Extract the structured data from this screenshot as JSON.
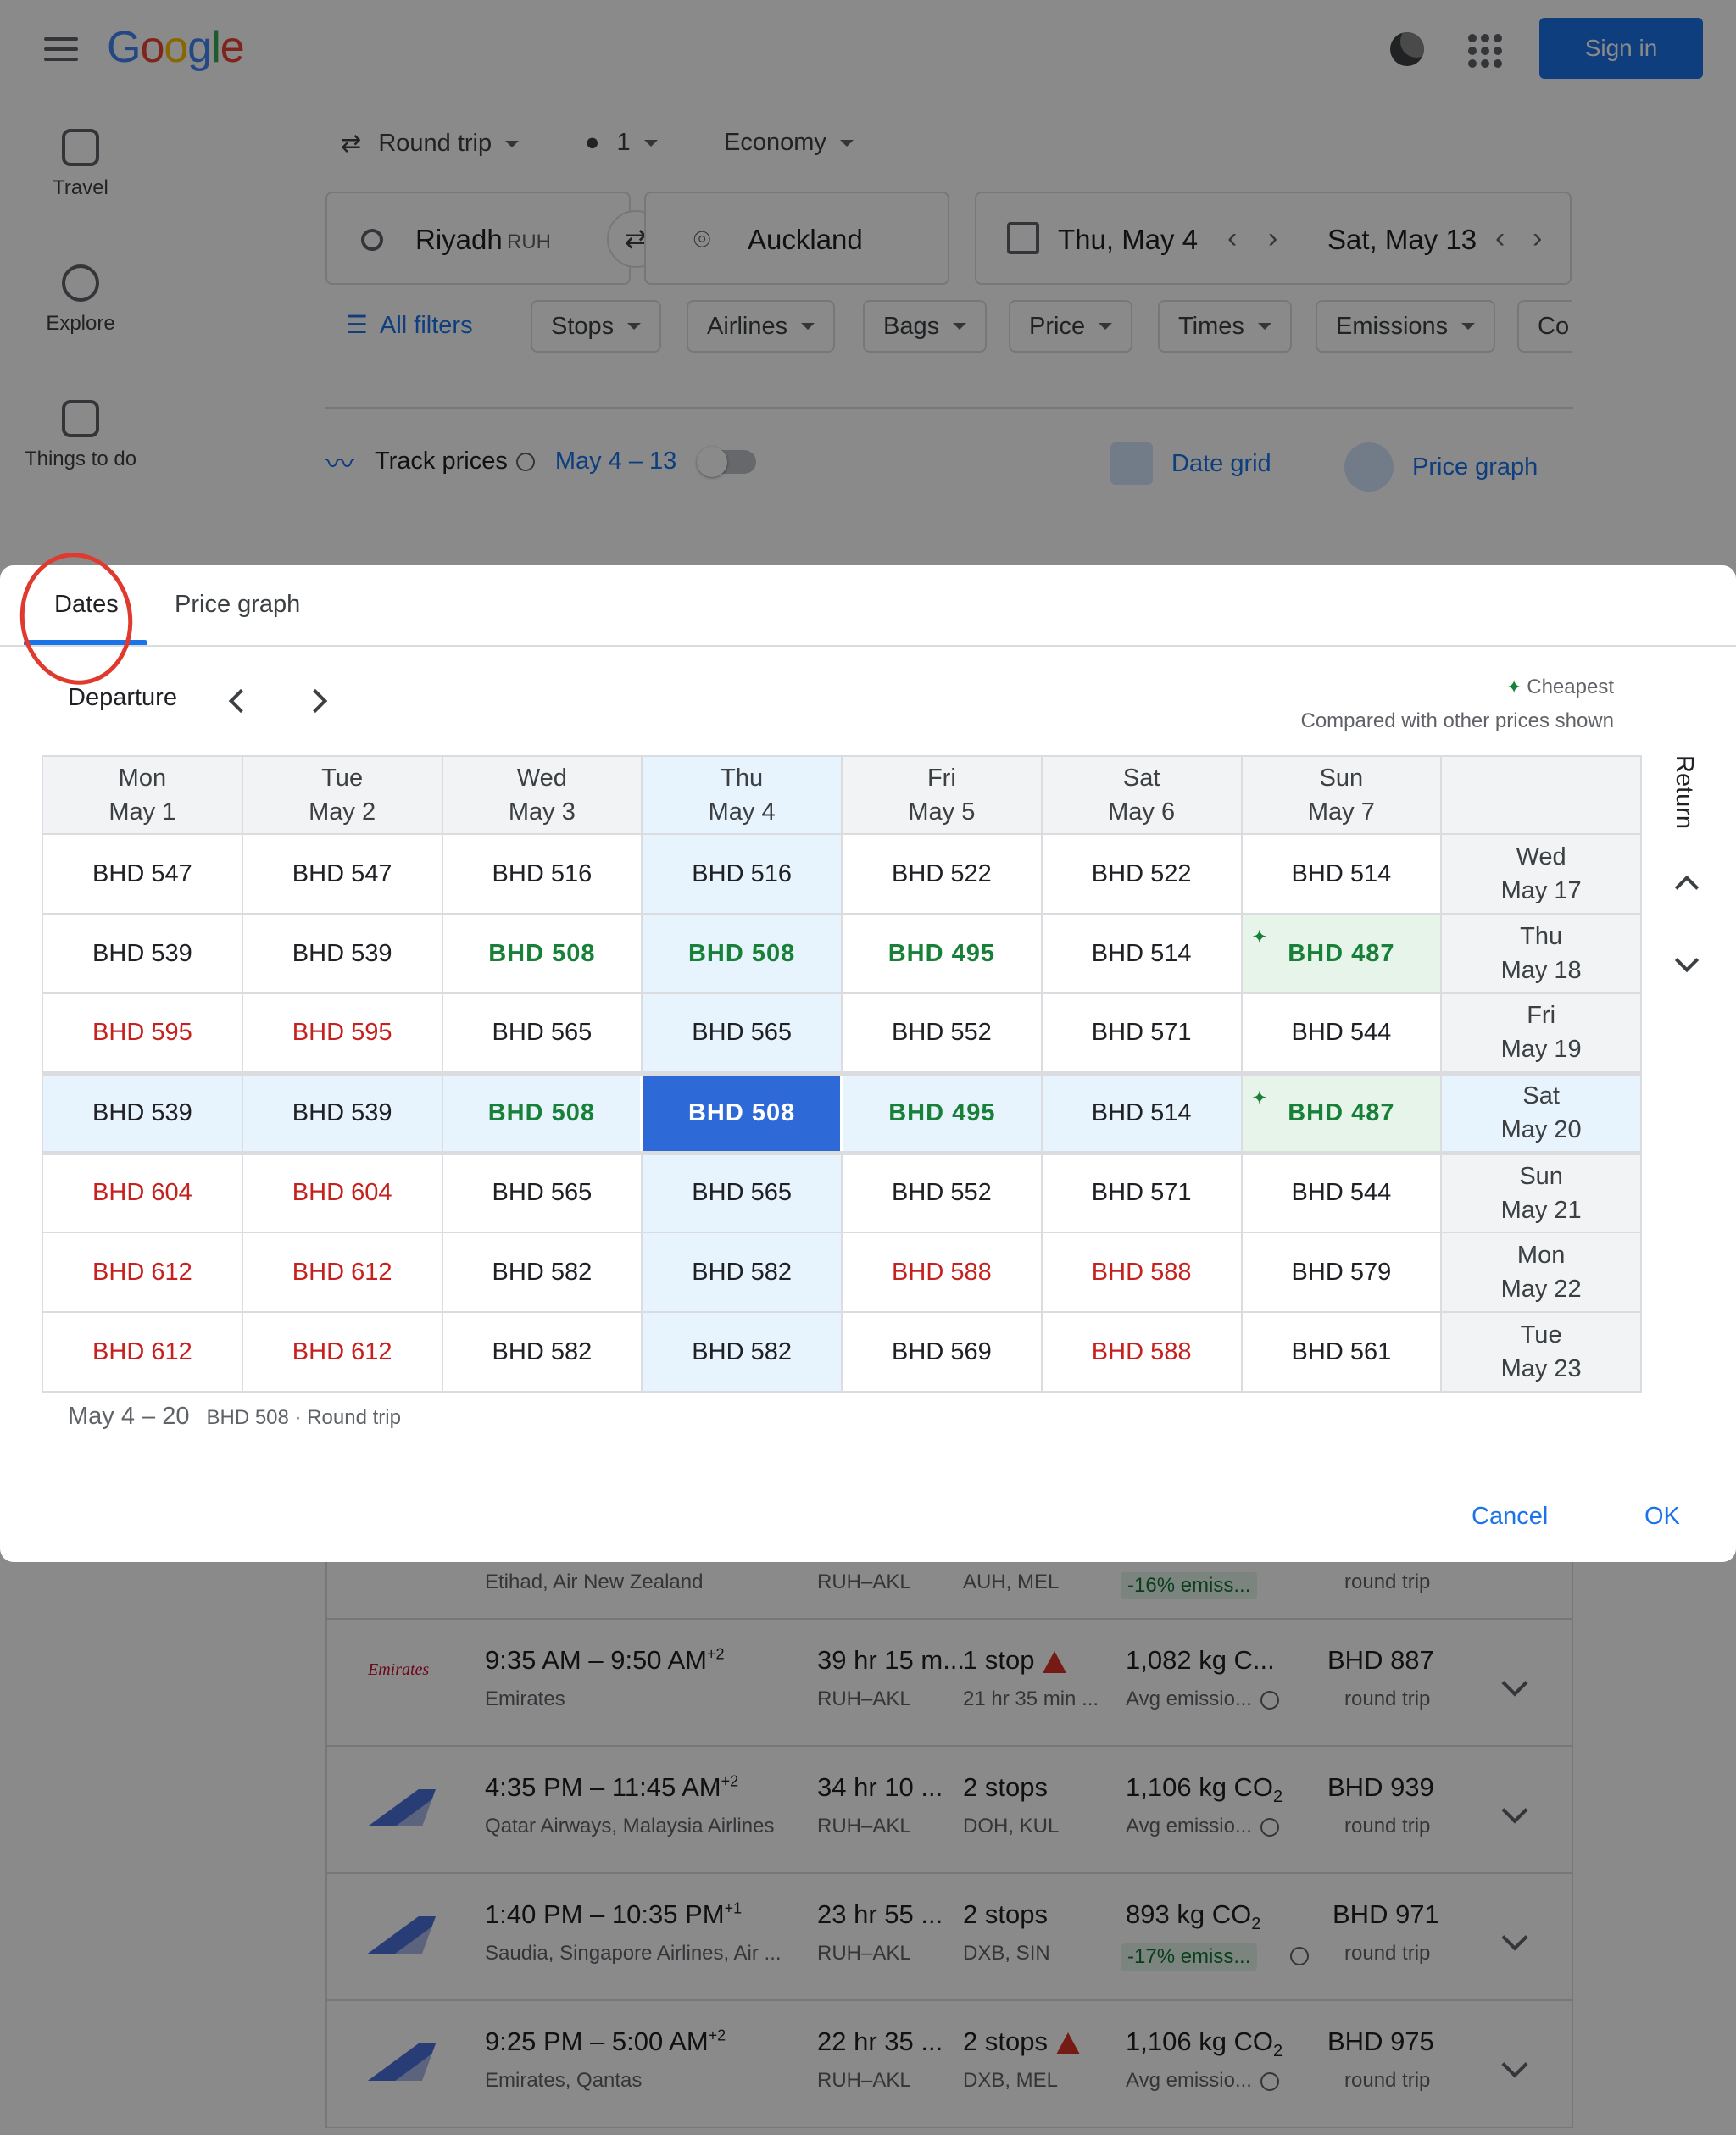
{
  "header": {
    "logo": [
      "G",
      "o",
      "o",
      "g",
      "l",
      "e"
    ],
    "logo_colors": [
      "#4285f4",
      "#ea4335",
      "#fbbc05",
      "#4285f4",
      "#34a853",
      "#ea4335"
    ],
    "signin_label": "Sign in"
  },
  "sidenav": {
    "items": [
      {
        "label": "Travel",
        "icon": "luggage-icon"
      },
      {
        "label": "Explore",
        "icon": "explore-icon"
      },
      {
        "label": "Things to do",
        "icon": "camera-icon"
      }
    ]
  },
  "search": {
    "trip_type": "Round trip",
    "passengers": "1",
    "cabin": "Economy",
    "origin": "Riyadh",
    "origin_code": "RUH",
    "destination": "Auckland",
    "depart_date": "Thu, May 4",
    "return_date": "Sat, May 13"
  },
  "filters": {
    "all_filters": "All filters",
    "chips": [
      "Stops",
      "Airlines",
      "Bags",
      "Price",
      "Times",
      "Emissions",
      "Co"
    ]
  },
  "track": {
    "label": "Track prices",
    "range": "May 4 – 13",
    "date_grid": "Date grid",
    "price_graph": "Price graph"
  },
  "flights": [
    {
      "airline_line": "Etihad, Air New Zealand",
      "route": "RUH–AKL",
      "stops_detail": "AUH, MEL",
      "emissions_badge": "-16% emiss...",
      "price_sub": "round trip"
    },
    {
      "times": "9:35 AM – 9:50 AM",
      "plus": "+2",
      "airline_line": "Emirates",
      "duration": "39 hr 15 m...",
      "route": "RUH–AKL",
      "stops": "1 stop",
      "stops_detail": "21 hr 35 min ...",
      "emissions": "1,082 kg C...",
      "emissions_sub": "Avg emissio...",
      "price": "BHD 887",
      "price_sub": "round trip",
      "logo_text": "Emirates"
    },
    {
      "times": "4:35 PM – 11:45 AM",
      "plus": "+2",
      "airline_line": "Qatar Airways, Malaysia Airlines",
      "duration": "34 hr 10 ...",
      "route": "RUH–AKL",
      "stops": "2 stops",
      "stops_detail": "DOH, KUL",
      "emissions": "1,106 kg CO",
      "emissions_sub": "Avg emissio...",
      "price": "BHD 939",
      "price_sub": "round trip"
    },
    {
      "times": "1:40 PM – 10:35 PM",
      "plus": "+1",
      "airline_line": "Saudia, Singapore Airlines, Air ...",
      "duration": "23 hr 55 ...",
      "route": "RUH–AKL",
      "stops": "2 stops",
      "stops_detail": "DXB, SIN",
      "emissions": "893 kg CO",
      "emissions_sub": "-17% emiss...",
      "price": "BHD 971",
      "price_sub": "round trip"
    },
    {
      "times": "9:25 PM – 5:00 AM",
      "plus": "+2",
      "airline_line": "Emirates, Qantas",
      "duration": "22 hr 35 ...",
      "route": "RUH–AKL",
      "stops": "2 stops",
      "stops_detail": "DXB, MEL",
      "emissions": "1,106 kg CO",
      "emissions_sub": "Avg emissio...",
      "price": "BHD 975",
      "price_sub": "round trip"
    }
  ],
  "dialog": {
    "tabs": [
      "Dates",
      "Price graph"
    ],
    "departure_label": "Departure",
    "cheapest_label": "Cheapest",
    "compared_label": "Compared with other prices shown",
    "return_label": "Return",
    "columns": [
      {
        "day": "Mon",
        "date": "May 1"
      },
      {
        "day": "Tue",
        "date": "May 2"
      },
      {
        "day": "Wed",
        "date": "May 3"
      },
      {
        "day": "Thu",
        "date": "May 4"
      },
      {
        "day": "Fri",
        "date": "May 5"
      },
      {
        "day": "Sat",
        "date": "May 6"
      },
      {
        "day": "Sun",
        "date": "May 7"
      }
    ],
    "rows": [
      {
        "day": "Wed",
        "date": "May 17",
        "cells": [
          [
            "BHD 547",
            "n"
          ],
          [
            "BHD 547",
            "n"
          ],
          [
            "BHD 516",
            "n"
          ],
          [
            "BHD 516",
            "n"
          ],
          [
            "BHD 522",
            "n"
          ],
          [
            "BHD 522",
            "n"
          ],
          [
            "BHD 514",
            "n"
          ]
        ]
      },
      {
        "day": "Thu",
        "date": "May 18",
        "cells": [
          [
            "BHD 539",
            "n"
          ],
          [
            "BHD 539",
            "n"
          ],
          [
            "BHD 508",
            "g"
          ],
          [
            "BHD 508",
            "g"
          ],
          [
            "BHD 495",
            "g"
          ],
          [
            "BHD 514",
            "n"
          ],
          [
            "BHD 487",
            "c"
          ]
        ]
      },
      {
        "day": "Fri",
        "date": "May 19",
        "cells": [
          [
            "BHD 595",
            "r"
          ],
          [
            "BHD 595",
            "r"
          ],
          [
            "BHD 565",
            "n"
          ],
          [
            "BHD 565",
            "n"
          ],
          [
            "BHD 552",
            "n"
          ],
          [
            "BHD 571",
            "n"
          ],
          [
            "BHD 544",
            "n"
          ]
        ]
      },
      {
        "day": "Sat",
        "date": "May 20",
        "cells": [
          [
            "BHD 539",
            "n"
          ],
          [
            "BHD 539",
            "n"
          ],
          [
            "BHD 508",
            "g"
          ],
          [
            "BHD 508",
            "s"
          ],
          [
            "BHD 495",
            "g"
          ],
          [
            "BHD 514",
            "n"
          ],
          [
            "BHD 487",
            "c"
          ]
        ]
      },
      {
        "day": "Sun",
        "date": "May 21",
        "cells": [
          [
            "BHD 604",
            "r"
          ],
          [
            "BHD 604",
            "r"
          ],
          [
            "BHD 565",
            "n"
          ],
          [
            "BHD 565",
            "n"
          ],
          [
            "BHD 552",
            "n"
          ],
          [
            "BHD 571",
            "n"
          ],
          [
            "BHD 544",
            "n"
          ]
        ]
      },
      {
        "day": "Mon",
        "date": "May 22",
        "cells": [
          [
            "BHD 612",
            "r"
          ],
          [
            "BHD 612",
            "r"
          ],
          [
            "BHD 582",
            "n"
          ],
          [
            "BHD 582",
            "n"
          ],
          [
            "BHD 588",
            "r"
          ],
          [
            "BHD 588",
            "r"
          ],
          [
            "BHD 579",
            "n"
          ]
        ]
      },
      {
        "day": "Tue",
        "date": "May 23",
        "cells": [
          [
            "BHD 612",
            "r"
          ],
          [
            "BHD 612",
            "r"
          ],
          [
            "BHD 582",
            "n"
          ],
          [
            "BHD 582",
            "n"
          ],
          [
            "BHD 569",
            "n"
          ],
          [
            "BHD 588",
            "r"
          ],
          [
            "BHD 561",
            "n"
          ]
        ]
      }
    ],
    "selected_col": 3,
    "selected_row": 3,
    "summary_dates": "May 4 – 20",
    "summary_price": "BHD 508 · Round trip",
    "cancel_label": "Cancel",
    "ok_label": "OK"
  },
  "colors": {
    "accent": "#1a73e8",
    "green_price": "#188038",
    "red_price": "#c5221f",
    "selected_cell": "#2d6ad8",
    "highlight": "#e8f4fd",
    "cheapest_bg": "#e6f4ea"
  }
}
